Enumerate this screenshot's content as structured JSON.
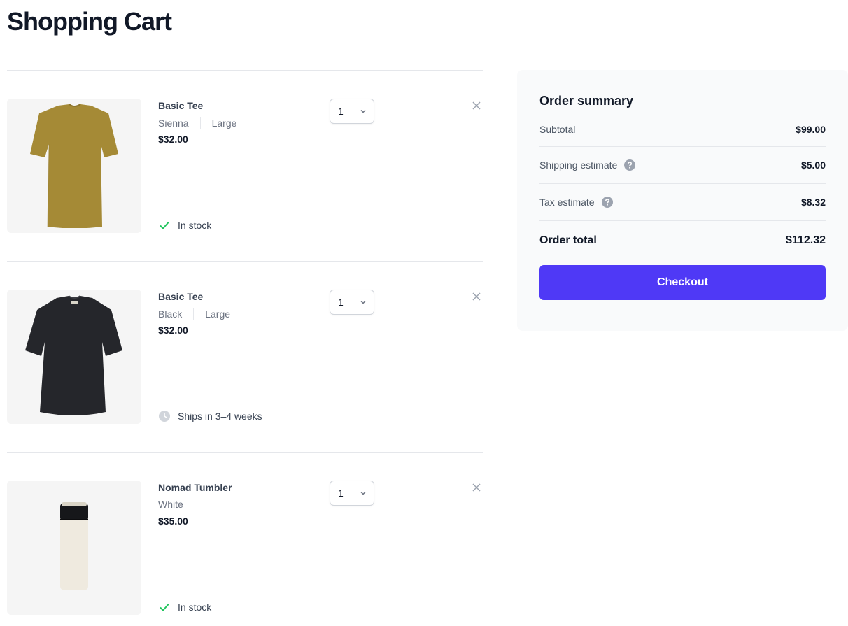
{
  "page": {
    "title": "Shopping Cart"
  },
  "items": [
    {
      "name": "Basic Tee",
      "color": "Sienna",
      "size": "Large",
      "price": "$32.00",
      "quantity": "1",
      "stock": "In stock",
      "stock_icon": "check-icon",
      "image_color": "#a58a36"
    },
    {
      "name": "Basic Tee",
      "color": "Black",
      "size": "Large",
      "price": "$32.00",
      "quantity": "1",
      "stock": "Ships in 3–4 weeks",
      "stock_icon": "clock-icon",
      "image_color": "#25262b"
    },
    {
      "name": "Nomad Tumbler",
      "color": "White",
      "price": "$35.00",
      "quantity": "1",
      "stock": "In stock",
      "stock_icon": "check-icon",
      "image_color": "#efeadf"
    }
  ],
  "summary": {
    "title": "Order summary",
    "subtotal_label": "Subtotal",
    "subtotal_value": "$99.00",
    "shipping_label": "Shipping estimate",
    "shipping_value": "$5.00",
    "tax_label": "Tax estimate",
    "tax_value": "$8.32",
    "total_label": "Order total",
    "total_value": "$112.32",
    "checkout_label": "Checkout"
  },
  "colors": {
    "accent": "#4f39f6",
    "in_stock": "#22c55e",
    "muted_icon": "#9ca3af"
  }
}
